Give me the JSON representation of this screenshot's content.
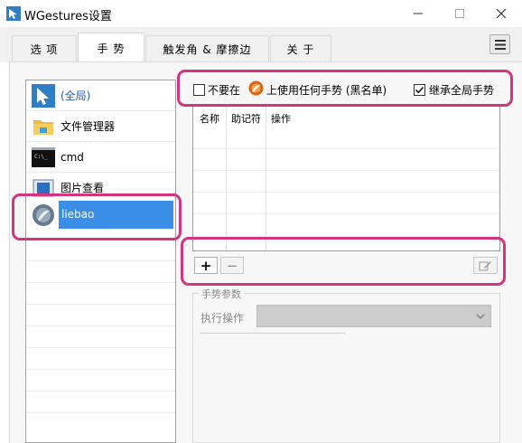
{
  "window": {
    "title": "WGestures设置"
  },
  "tabs": [
    {
      "label": "选 项",
      "active": false
    },
    {
      "label": "手 势",
      "active": true
    },
    {
      "label": "触发角 & 摩擦边",
      "active": false
    },
    {
      "label": "关 于",
      "active": false
    }
  ],
  "apps": [
    {
      "label": "(全局)",
      "icon": "cursor-icon"
    },
    {
      "label": "文件管理器",
      "icon": "folder-icon"
    },
    {
      "label": "cmd",
      "icon": "terminal-icon"
    },
    {
      "label": "图片查看",
      "icon": "image-viewer-icon"
    },
    {
      "label": "liebao",
      "icon": "liebao-icon",
      "selected": true
    }
  ],
  "options": {
    "disable_prefix": "不要在",
    "disable_suffix": "上使用任何手势 (黑名单)",
    "disable_checked": false,
    "inherit_label": "继承全局手势",
    "inherit_checked": true
  },
  "gesture_table": {
    "columns": [
      "名称",
      "助记符",
      "操作"
    ]
  },
  "buttons": {
    "add": "+",
    "remove": "−"
  },
  "params": {
    "group_title": "手势参数",
    "exec_label": "执行操作",
    "exec_value": ""
  },
  "colors": {
    "accent": "#3a8ee6",
    "highlight": "#d2357d"
  }
}
